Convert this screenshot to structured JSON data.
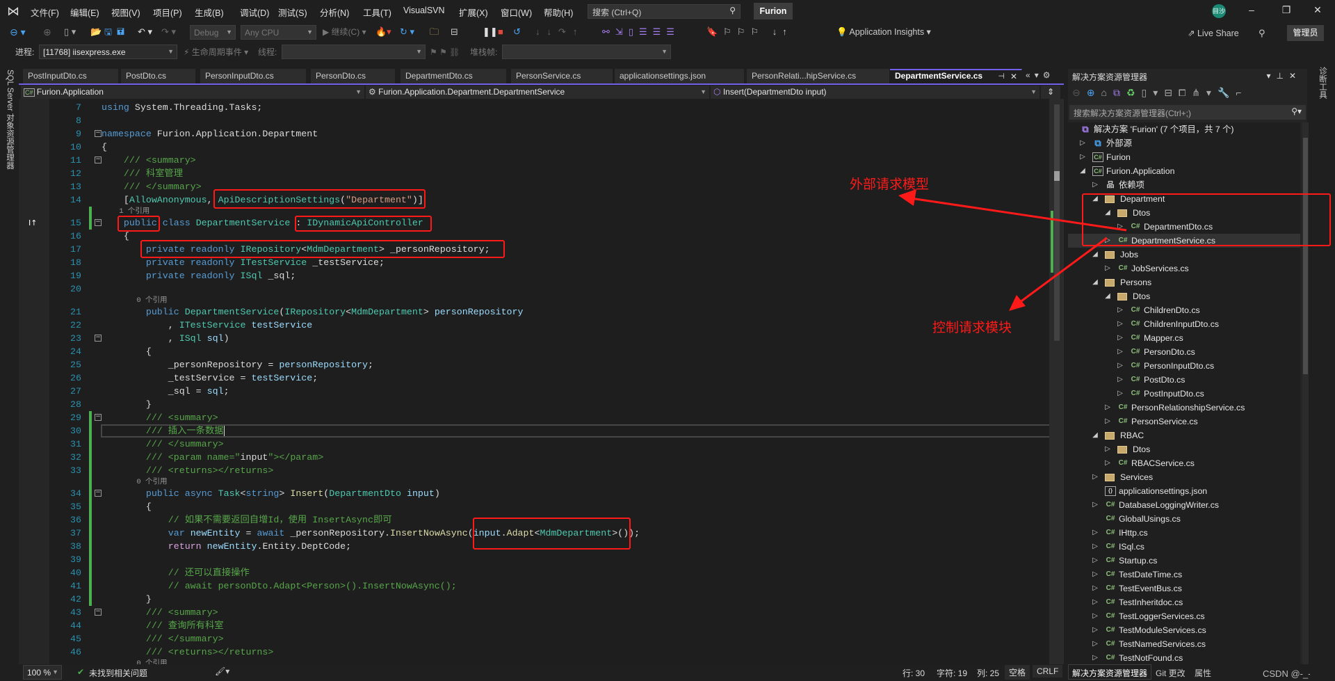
{
  "titlebar": {
    "menus": [
      "文件(F)",
      "编辑(E)",
      "视图(V)",
      "项目(P)",
      "生成(B)",
      "调试(D)",
      "测试(S)",
      "分析(N)",
      "工具(T)",
      "VisualSVN",
      "扩展(X)",
      "窗口(W)",
      "帮助(H)"
    ],
    "search_placeholder": "搜索 (Ctrl+Q)",
    "solution_name": "Furion",
    "avatar_initials": "目沙"
  },
  "toolbar": {
    "config": "Debug",
    "platform": "Any CPU",
    "continue": "继续(C)",
    "app_insights": "Application Insights",
    "live_share": "Live Share",
    "admin": "管理员"
  },
  "debugbar": {
    "process_label": "进程:",
    "process": "[11768] iisexpress.exe",
    "lifecycle": "生命周期事件",
    "thread_label": "线程:",
    "thread": "",
    "stack_label": "堆栈帧:",
    "stack": ""
  },
  "tabs": [
    {
      "label": "PostInputDto.cs"
    },
    {
      "label": "PostDto.cs"
    },
    {
      "label": "PersonInputDto.cs"
    },
    {
      "label": "PersonDto.cs"
    },
    {
      "label": "DepartmentDto.cs"
    },
    {
      "label": "PersonService.cs"
    },
    {
      "label": "applicationsettings.json"
    },
    {
      "label": "PersonRelati...hipService.cs"
    },
    {
      "label": "DepartmentService.cs",
      "active": true
    }
  ],
  "navbar": {
    "project": "Furion.Application",
    "type": "Furion.Application.Department.DepartmentService",
    "member": "Insert(DepartmentDto input)"
  },
  "left_strip": "SQL Server 对象资源管理器",
  "right_strip": "诊断工具",
  "colors": {
    "accent": "#7160e8",
    "annotation": "#ff1a1a",
    "changed": "#4caf50"
  },
  "code": [
    {
      "n": 7,
      "t": [
        [
          "k",
          "using"
        ],
        " System.Threading.Tasks;"
      ]
    },
    {
      "n": 8,
      "t": []
    },
    {
      "n": 9,
      "fold": true,
      "t": [
        [
          "k",
          "namespace"
        ],
        " Furion.Application.Department"
      ]
    },
    {
      "n": 10,
      "t": [
        "{"
      ]
    },
    {
      "n": 11,
      "fold": true,
      "t": [
        "    ",
        [
          "c",
          "/// <summary>"
        ]
      ]
    },
    {
      "n": 12,
      "t": [
        "    ",
        [
          "c",
          "/// 科室管理"
        ]
      ]
    },
    {
      "n": 13,
      "t": [
        "    ",
        [
          "c",
          "/// </summary>"
        ]
      ]
    },
    {
      "n": 14,
      "t": [
        "    [",
        [
          "t",
          "AllowAnonymous"
        ],
        ", ",
        [
          "t",
          "ApiDescriptionSettings"
        ],
        "(",
        [
          "s",
          "\"Department\""
        ],
        ")]"
      ]
    },
    {
      "lens": "    1 个引用",
      "chg": true
    },
    {
      "n": 15,
      "fold": true,
      "chg": true,
      "t": [
        "    ",
        [
          "k",
          "public"
        ],
        " ",
        [
          "k",
          "class"
        ],
        " ",
        [
          "t",
          "DepartmentService"
        ],
        " : ",
        [
          "t",
          "IDynamicApiController"
        ]
      ]
    },
    {
      "n": 16,
      "t": [
        "    {"
      ]
    },
    {
      "n": 17,
      "t": [
        "        ",
        [
          "k",
          "private"
        ],
        " ",
        [
          "k",
          "readonly"
        ],
        " ",
        [
          "t",
          "IRepository"
        ],
        "<",
        [
          "t",
          "MdmDepartment"
        ],
        "> _personRepository;"
      ]
    },
    {
      "n": 18,
      "t": [
        "        ",
        [
          "k",
          "private"
        ],
        " ",
        [
          "k",
          "readonly"
        ],
        " ",
        [
          "t",
          "ITestService"
        ],
        " _testService;"
      ]
    },
    {
      "n": 19,
      "t": [
        "        ",
        [
          "k",
          "private"
        ],
        " ",
        [
          "k",
          "readonly"
        ],
        " ",
        [
          "t",
          "ISql"
        ],
        " _sql;"
      ]
    },
    {
      "n": 20,
      "t": []
    },
    {
      "lens": "        0 个引用"
    },
    {
      "n": 21,
      "t": [
        "        ",
        [
          "k",
          "public"
        ],
        " ",
        [
          "t",
          "DepartmentService"
        ],
        "(",
        [
          "t",
          "IRepository"
        ],
        "<",
        [
          "t",
          "MdmDepartment"
        ],
        "> ",
        [
          "p",
          "personRepository"
        ]
      ]
    },
    {
      "n": 22,
      "t": [
        "            , ",
        [
          "t",
          "ITestService"
        ],
        " ",
        [
          "p",
          "testService"
        ]
      ]
    },
    {
      "n": 23,
      "fold": true,
      "t": [
        "            , ",
        [
          "t",
          "ISql"
        ],
        " ",
        [
          "p",
          "sql"
        ],
        ")"
      ]
    },
    {
      "n": 24,
      "t": [
        "        {"
      ]
    },
    {
      "n": 25,
      "t": [
        "            _personRepository = ",
        [
          "p",
          "personRepository"
        ],
        ";"
      ]
    },
    {
      "n": 26,
      "t": [
        "            _testService = ",
        [
          "p",
          "testService"
        ],
        ";"
      ]
    },
    {
      "n": 27,
      "t": [
        "            _sql = ",
        [
          "p",
          "sql"
        ],
        ";"
      ]
    },
    {
      "n": 28,
      "t": [
        "        }"
      ]
    },
    {
      "n": 29,
      "fold": true,
      "chg": true,
      "t": [
        "        ",
        [
          "c",
          "/// <summary>"
        ]
      ]
    },
    {
      "n": 30,
      "chg": true,
      "current": true,
      "t": [
        "        ",
        [
          "c",
          "/// 插入一条数据"
        ]
      ]
    },
    {
      "n": 31,
      "chg": true,
      "t": [
        "        ",
        [
          "c",
          "/// </summary>"
        ]
      ]
    },
    {
      "n": 32,
      "chg": true,
      "t": [
        "        ",
        [
          "c",
          "/// <param name=\""
        ],
        "input",
        [
          "c",
          "\"></param>"
        ]
      ]
    },
    {
      "n": 33,
      "chg": true,
      "t": [
        "        ",
        [
          "c",
          "/// <returns></returns>"
        ]
      ]
    },
    {
      "lens": "        0 个引用",
      "chg": true
    },
    {
      "n": 34,
      "fold": true,
      "chg": true,
      "t": [
        "        ",
        [
          "k",
          "public"
        ],
        " ",
        [
          "k",
          "async"
        ],
        " ",
        [
          "t",
          "Task"
        ],
        "<",
        [
          "k",
          "string"
        ],
        "> ",
        [
          "m",
          "Insert"
        ],
        "(",
        [
          "t",
          "DepartmentDto"
        ],
        " ",
        [
          "p",
          "input"
        ],
        ")"
      ]
    },
    {
      "n": 35,
      "chg": true,
      "t": [
        "        {"
      ]
    },
    {
      "n": 36,
      "chg": true,
      "t": [
        "            ",
        [
          "c",
          "// 如果不需要返回自增Id，使用 InsertAsync即可"
        ]
      ]
    },
    {
      "n": 37,
      "chg": true,
      "t": [
        "            ",
        [
          "k",
          "var"
        ],
        " ",
        [
          "p",
          "newEntity"
        ],
        " = ",
        [
          "k",
          "await"
        ],
        " _personRepository.",
        [
          "m",
          "InsertNowAsync"
        ],
        "(",
        [
          "p",
          "input"
        ],
        ".",
        [
          "m",
          "Adapt"
        ],
        "<",
        [
          "t",
          "MdmDepartment"
        ],
        ">());"
      ]
    },
    {
      "n": 38,
      "chg": true,
      "t": [
        "            ",
        [
          "r",
          "return"
        ],
        " ",
        [
          "p",
          "newEntity"
        ],
        ".Entity.DeptCode;"
      ]
    },
    {
      "n": 39,
      "chg": true,
      "t": []
    },
    {
      "n": 40,
      "chg": true,
      "t": [
        "            ",
        [
          "c",
          "// 还可以直接操作"
        ]
      ]
    },
    {
      "n": 41,
      "chg": true,
      "t": [
        "            ",
        [
          "c",
          "// await personDto.Adapt<Person>().InsertNowAsync();"
        ]
      ]
    },
    {
      "n": 42,
      "chg": true,
      "t": [
        "        }"
      ]
    },
    {
      "n": 43,
      "fold": true,
      "t": [
        "        ",
        [
          "c",
          "/// <summary>"
        ]
      ]
    },
    {
      "n": 44,
      "t": [
        "        ",
        [
          "c",
          "/// 查询所有科室"
        ]
      ]
    },
    {
      "n": 45,
      "t": [
        "        ",
        [
          "c",
          "/// </summary>"
        ]
      ]
    },
    {
      "n": 46,
      "t": [
        "        ",
        [
          "c",
          "/// <returns></returns>"
        ]
      ]
    },
    {
      "lens": "        0 个引用"
    }
  ],
  "editor_status": {
    "zoom": "100 %",
    "issues": "未找到相关问题",
    "line": "行: 30",
    "char": "字符: 19",
    "col": "列: 25",
    "spaces": "空格",
    "eol": "CRLF"
  },
  "solution_explorer": {
    "title": "解决方案资源管理器",
    "search_placeholder": "搜索解决方案资源管理器(Ctrl+;)",
    "items": [
      {
        "label": "解决方案 'Furion' (7 个项目，共 7 个)",
        "level": -1,
        "arrow": "none",
        "icon": "solution"
      },
      {
        "label": "外部源",
        "level": 0,
        "arrow": "collapsed",
        "icon": "external"
      },
      {
        "label": "Furion",
        "level": 0,
        "arrow": "collapsed",
        "icon": "proj"
      },
      {
        "label": "Furion.Application",
        "level": 0,
        "arrow": "expanded",
        "icon": "proj"
      },
      {
        "label": "依赖项",
        "level": 1,
        "arrow": "collapsed",
        "icon": "deps"
      },
      {
        "label": "Department",
        "level": 1,
        "arrow": "expanded",
        "icon": "folder"
      },
      {
        "label": "Dtos",
        "level": 2,
        "arrow": "expanded",
        "icon": "folder"
      },
      {
        "label": "DepartmentDto.cs",
        "level": 3,
        "arrow": "collapsed",
        "icon": "cs"
      },
      {
        "label": "DepartmentService.cs",
        "level": 2,
        "arrow": "collapsed",
        "icon": "cs",
        "selected": true
      },
      {
        "label": "Jobs",
        "level": 1,
        "arrow": "expanded",
        "icon": "folder"
      },
      {
        "label": "JobServices.cs",
        "level": 2,
        "arrow": "collapsed",
        "icon": "cs"
      },
      {
        "label": "Persons",
        "level": 1,
        "arrow": "expanded",
        "icon": "folder"
      },
      {
        "label": "Dtos",
        "level": 2,
        "arrow": "expanded",
        "icon": "folder"
      },
      {
        "label": "ChildrenDto.cs",
        "level": 3,
        "arrow": "collapsed",
        "icon": "cs"
      },
      {
        "label": "ChildrenInputDto.cs",
        "level": 3,
        "arrow": "collapsed",
        "icon": "cs"
      },
      {
        "label": "Mapper.cs",
        "level": 3,
        "arrow": "collapsed",
        "icon": "cs"
      },
      {
        "label": "PersonDto.cs",
        "level": 3,
        "arrow": "collapsed",
        "icon": "cs"
      },
      {
        "label": "PersonInputDto.cs",
        "level": 3,
        "arrow": "collapsed",
        "icon": "cs"
      },
      {
        "label": "PostDto.cs",
        "level": 3,
        "arrow": "collapsed",
        "icon": "cs"
      },
      {
        "label": "PostInputDto.cs",
        "level": 3,
        "arrow": "collapsed",
        "icon": "cs"
      },
      {
        "label": "PersonRelationshipService.cs",
        "level": 2,
        "arrow": "collapsed",
        "icon": "cs"
      },
      {
        "label": "PersonService.cs",
        "level": 2,
        "arrow": "collapsed",
        "icon": "cs"
      },
      {
        "label": "RBAC",
        "level": 1,
        "arrow": "expanded",
        "icon": "folder"
      },
      {
        "label": "Dtos",
        "level": 2,
        "arrow": "collapsed",
        "icon": "folder"
      },
      {
        "label": "RBACService.cs",
        "level": 2,
        "arrow": "collapsed",
        "icon": "cs"
      },
      {
        "label": "Services",
        "level": 1,
        "arrow": "collapsed",
        "icon": "folder"
      },
      {
        "label": "applicationsettings.json",
        "level": 1,
        "arrow": "none",
        "icon": "json"
      },
      {
        "label": "DatabaseLoggingWriter.cs",
        "level": 1,
        "arrow": "collapsed",
        "icon": "cs"
      },
      {
        "label": "GlobalUsings.cs",
        "level": 1,
        "arrow": "none",
        "icon": "cs"
      },
      {
        "label": "IHttp.cs",
        "level": 1,
        "arrow": "collapsed",
        "icon": "cs"
      },
      {
        "label": "ISql.cs",
        "level": 1,
        "arrow": "collapsed",
        "icon": "cs"
      },
      {
        "label": "Startup.cs",
        "level": 1,
        "arrow": "collapsed",
        "icon": "cs"
      },
      {
        "label": "TestDateTime.cs",
        "level": 1,
        "arrow": "collapsed",
        "icon": "cs"
      },
      {
        "label": "TestEventBus.cs",
        "level": 1,
        "arrow": "collapsed",
        "icon": "cs"
      },
      {
        "label": "TestInheritdoc.cs",
        "level": 1,
        "arrow": "collapsed",
        "icon": "cs"
      },
      {
        "label": "TestLoggerServices.cs",
        "level": 1,
        "arrow": "collapsed",
        "icon": "cs"
      },
      {
        "label": "TestModuleServices.cs",
        "level": 1,
        "arrow": "collapsed",
        "icon": "cs"
      },
      {
        "label": "TestNamedServices.cs",
        "level": 1,
        "arrow": "collapsed",
        "icon": "cs"
      },
      {
        "label": "TestNotFound.cs",
        "level": 1,
        "arrow": "collapsed",
        "icon": "cs"
      }
    ],
    "bottom_tabs": [
      "解决方案资源管理器",
      "Git 更改",
      "属性"
    ]
  },
  "annotations": {
    "model": "外部请求模型",
    "controller": "控制请求模块"
  },
  "watermark": "CSDN @-_-||元"
}
